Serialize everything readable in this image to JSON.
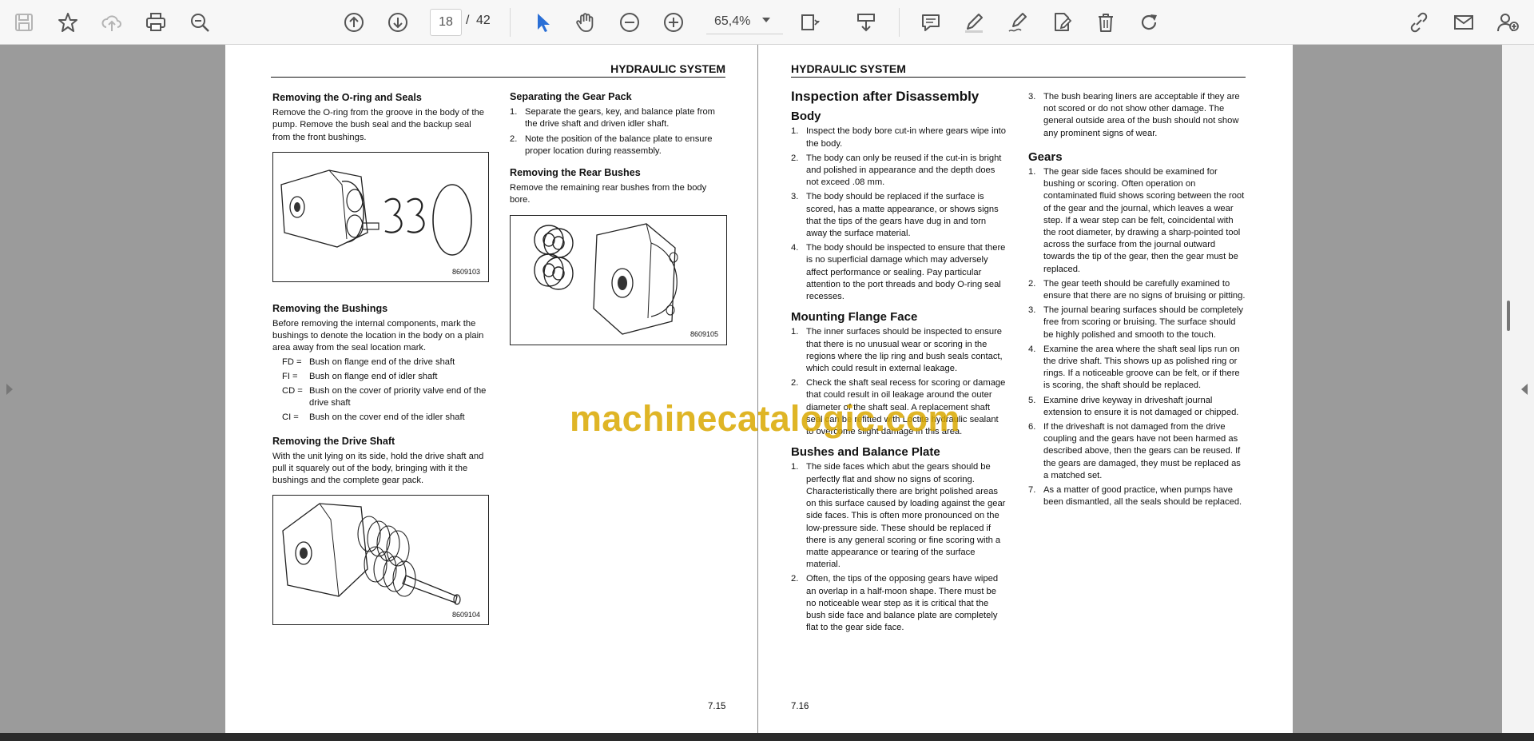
{
  "toolbar": {
    "icons": [
      "save-icon",
      "bookmark-star-icon",
      "cloud-upload-icon",
      "print-icon",
      "zoom-search-icon",
      "page-up-icon",
      "page-down-icon",
      "select-pointer-icon",
      "hand-pan-icon",
      "zoom-out-icon",
      "zoom-in-icon",
      "fit-page-icon",
      "scroll-mode-icon",
      "comment-icon",
      "pen-icon",
      "sign-icon",
      "edit-document-icon",
      "delete-icon",
      "redo-icon",
      "share-link-icon",
      "email-icon",
      "add-user-icon"
    ],
    "page_current": "18",
    "page_separator": "/",
    "page_total": "42",
    "zoom_value": "65,4%"
  },
  "colors": {
    "toolbar_bg": "#f7f7f7",
    "viewer_gray": "#9b9b9b",
    "accent_blue": "#2a6fd6",
    "watermark": "#d9a800"
  },
  "left_page": {
    "header": "HYDRAULIC SYSTEM",
    "page_number": "7.15",
    "col1": {
      "oring_title": "Removing the O-ring and Seals",
      "oring_text": "Remove the O-ring from the groove in the body of the pump. Remove the bush seal and the backup seal from the front bushings.",
      "fig1_code": "8609103",
      "bushings_title": "Removing the Bushings",
      "bushings_text": "Before removing the internal components, mark the bushings to denote the location in the body on a plain area away from the seal location mark.",
      "bushings_list": [
        {
          "code": "FD =",
          "desc": "Bush on flange end of the drive shaft"
        },
        {
          "code": "FI =",
          "desc": "Bush on flange end of idler shaft"
        },
        {
          "code": "CD =",
          "desc": "Bush on the cover of priority valve end of the drive shaft"
        },
        {
          "code": "CI =",
          "desc": "Bush on the cover end of the idler shaft"
        }
      ],
      "drive_title": "Removing the Drive Shaft",
      "drive_text": "With the unit lying on its side, hold the drive shaft and pull it squarely out of the body, bringing with it the bushings and the complete gear pack.",
      "fig3_code": "8609104"
    },
    "col2": {
      "gear_title": "Separating the Gear Pack",
      "gear_list": [
        "Separate the gears, key, and balance plate from the drive shaft and driven idler shaft.",
        "Note the position of the balance plate to ensure proper location during reassembly."
      ],
      "rear_title": "Removing the Rear Bushes",
      "rear_text": "Remove the remaining rear bushes from the body bore.",
      "fig2_code": "8609105"
    }
  },
  "right_page": {
    "header": "HYDRAULIC SYSTEM",
    "page_number": "7.16",
    "col1": {
      "main_title": "Inspection after Disassembly",
      "body_title": "Body",
      "body_list": [
        "Inspect the body bore cut-in where gears wipe into the body.",
        "The body can only be reused if the cut-in is bright and polished in appearance and the depth does not exceed .08 mm.",
        "The body should be replaced if the surface is scored, has a matte appearance, or shows signs that the tips of the gears have dug in and torn away the surface material.",
        "The body should be inspected to ensure that there is no superficial damage which may adversely affect performance or sealing. Pay particular attention to the port threads and body O-ring seal recesses."
      ],
      "flange_title": "Mounting Flange Face",
      "flange_list": [
        "The inner surfaces should be inspected to ensure that there is no unusual wear or scoring in the regions where the lip ring and bush seals contact, which could result in external leakage.",
        "Check the shaft seal recess for scoring or damage that could result in oil leakage around the outer diameter of the shaft seal. A replacement shaft seal can be refitted with Loctite hydraulic sealant to overcome slight damage in this area."
      ],
      "bushes_title": "Bushes and Balance Plate",
      "bushes_list": [
        "The side faces which abut the gears should be perfectly flat and show no signs of scoring. Characteristically there are bright polished areas on this surface caused by loading against the gear side faces. This is often more pronounced on the low-pressure side. These should be replaced if there is any general scoring or fine scoring with a matte appearance or tearing of the surface material.",
        "Often, the tips of the opposing gears have wiped an overlap in a half-moon shape. There must be no noticeable wear step as it is critical that the bush side face and balance plate are completely flat to the gear side face."
      ]
    },
    "col2": {
      "bush_item3": "The bush bearing liners are acceptable if they are not scored or do not show other damage. The general outside area of the bush should not show any prominent signs of wear.",
      "gears_title": "Gears",
      "gears_list": [
        "The gear side faces should be examined for bushing or scoring. Often operation on contaminated fluid shows scoring between the root of the gear and the journal, which leaves a wear step. If a wear step can be felt, coincidental with the root diameter, by drawing a sharp-pointed tool across the surface from the journal outward towards the tip of the gear, then the gear must be replaced.",
        "The gear teeth should be carefully examined to ensure that there are no signs of bruising or pitting.",
        "The journal bearing surfaces should be completely free from scoring or bruising. The surface should be highly polished and smooth to the touch.",
        "Examine the area where the shaft seal lips run on the drive shaft. This shows up as polished ring or rings. If a noticeable groove can be felt, or if there is scoring, the shaft should be replaced.",
        "Examine drive keyway in driveshaft journal extension to ensure it is not damaged or chipped.",
        "If the driveshaft is not damaged from the drive coupling and the gears have not been harmed as described above, then the gears can be reused. If the gears are damaged, they must be replaced as a matched set.",
        "As a matter of good practice, when pumps have been dismantled, all the seals should be replaced."
      ]
    }
  },
  "watermark": "machinecatalogic.com"
}
